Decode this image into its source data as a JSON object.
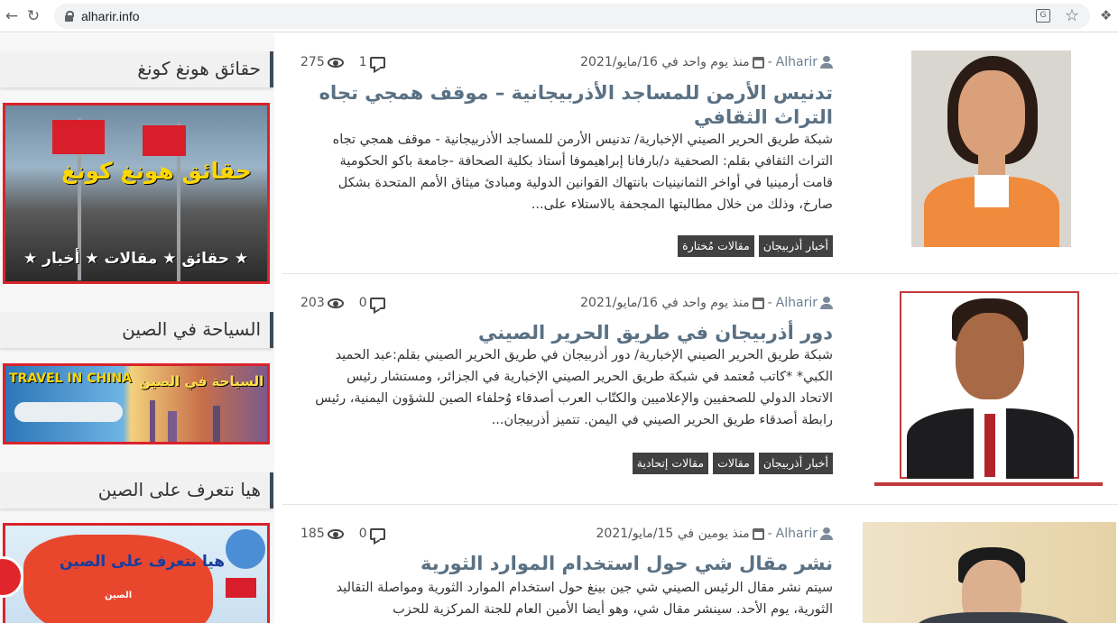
{
  "browser": {
    "url": "alharir.info",
    "back_icon": "arrow-left-icon",
    "reload_icon": "reload-icon"
  },
  "sidebar": {
    "widgets": [
      {
        "title": "حقائق هونغ كونغ",
        "banner_text_1": "حقائق هونغ كونغ",
        "banner_text_2": "★ حقائق ★ مقالات ★ أخبار ★"
      },
      {
        "title": "السياحة في الصين",
        "banner_text_en": "TRAVEL IN CHINA",
        "banner_text_ar": "السياحة في الصين"
      },
      {
        "title": "هيا نتعرف على الصين",
        "banner_text_ar": "هيا نتعرف على الصين",
        "map_label": "الصين"
      }
    ]
  },
  "posts": [
    {
      "author": "Alharir",
      "date": "منذ يوم واحد في 16/مايو/2021",
      "comments": "1",
      "views": "275",
      "title": "تدنيس الأرمن للمساجد الأذربيجانية – موقف همجي تجاه التراث الثقافي",
      "excerpt": "شبكة طريق الحرير الصيني الإخبارية/  تدنيس الأرمن للمساجد الأذربيجانية - موقف همجي تجاه التراث الثقافي   بقلم: الصحفية د/بارفانا إبراهيموفا  أستاذ بكلية الصحافة -جامعة باكو الحكومية     قامت أرمينيا في أواخر الثمانينيات بانتهاك القوانين الدولية ومبادئ ميثاق الأمم المتحدة بشكل صارخ، وذلك من خلال مطالبتها المجحفة بالاستلاء على...",
      "tags": [
        "أخبار أذربيجان",
        "مقالات مُختارة"
      ]
    },
    {
      "author": "Alharir",
      "date": "منذ يوم واحد في 16/مايو/2021",
      "comments": "0",
      "views": "203",
      "title": "دور أذربيجان في طريق الحرير الصيني",
      "excerpt": "شبكة طريق الحرير الصيني الإخبارية/  دور أذربيجان في طريق الحرير الصيني    بقلم:عبد الحميد الكبي* *كاتب مُعتمد في شبكة طريق الحرير الصيني الإخبارية في الجزائر، ومستشار رئيس الاتحاد الدولي للصحفيين والإعلاميين والكتّاب العرب أصدقاء وُحلفاء الصين للشؤون اليمنية، رئيس رابطة أصدقاء طريق الحرير الصيني في اليمن.     تتميز أذربيجان...",
      "tags": [
        "أخبار أذربيجان",
        "مقالات",
        "مقالات إتحادية"
      ]
    },
    {
      "author": "Alharir",
      "date": "منذ يومين في 15/مايو/2021",
      "comments": "0",
      "views": "185",
      "title": "نشر مقال شي حول استخدام الموارد الثورية",
      "excerpt": "سيتم نشر مقال الرئيس الصيني شي جين بينغ حول استخدام الموارد الثورية ومواصلة التقاليد الثورية، يوم الأحد. سينشر مقال شي، وهو أيضا الأمين العام للجنة المركزية للحزب",
      "tags": []
    }
  ]
}
